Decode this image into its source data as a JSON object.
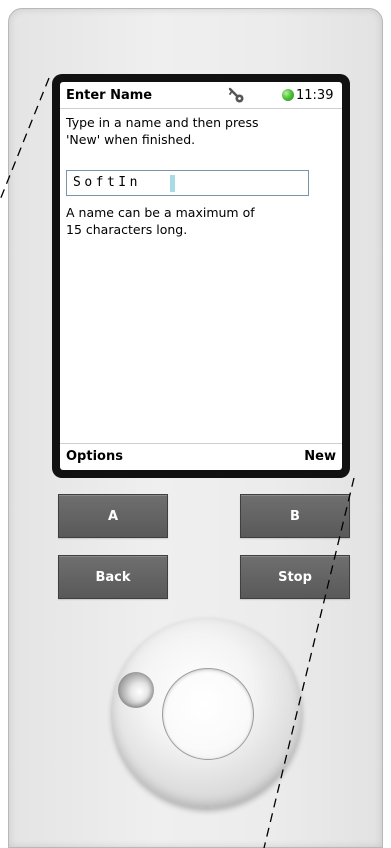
{
  "screen": {
    "status_bar": {
      "title": "Enter Name",
      "icon": "key-icon",
      "status_indicator_color": "#4fc23a",
      "time": "11:39"
    },
    "instruction": "Type in a name and then press\n'New' when finished.",
    "name_input": {
      "value": "SoftIn"
    },
    "limit_note": "A name can be a maximum of\n15 characters long.",
    "softkeys": {
      "left": "Options",
      "right": "New"
    }
  },
  "hardware_buttons": {
    "a": "A",
    "b": "B",
    "back": "Back",
    "stop": "Stop"
  },
  "colors": {
    "button_bg": "#5f5f5f",
    "bezel": "#111111",
    "device_body": "#eaeaea"
  }
}
